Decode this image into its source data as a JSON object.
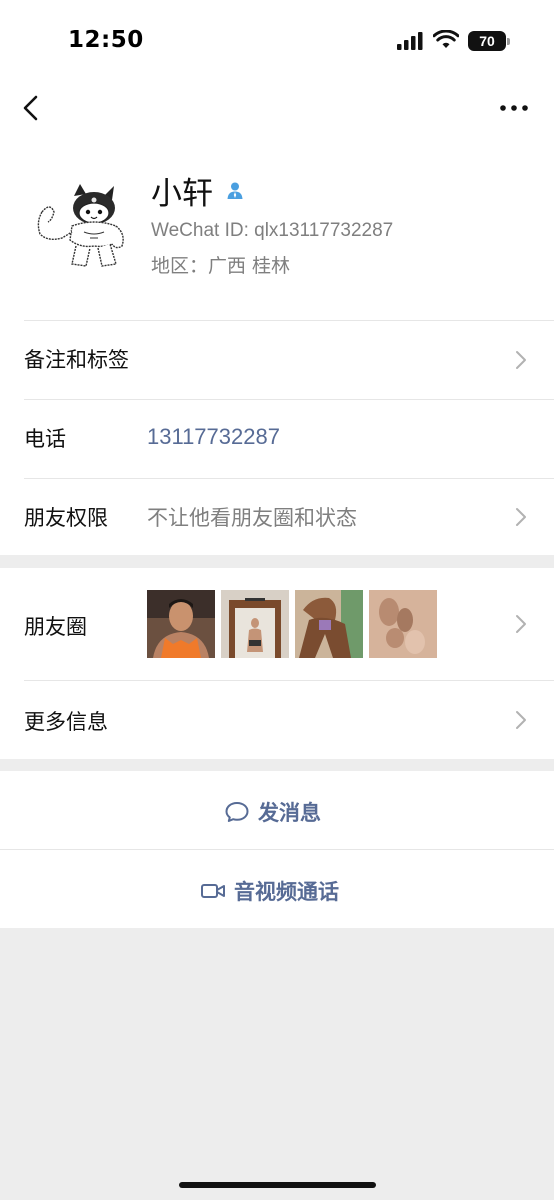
{
  "status_bar": {
    "time": "12:50",
    "battery": "70"
  },
  "profile": {
    "name": "小轩",
    "wechat_id": "WeChat ID: qlx13117732287",
    "region": "地区：广西 桂林"
  },
  "rows": {
    "remark": {
      "label": "备注和标签"
    },
    "phone": {
      "label": "电话",
      "value": "13117732287"
    },
    "permissions": {
      "label": "朋友权限",
      "value": "不让他看朋友圈和状态"
    },
    "moments": {
      "label": "朋友圈"
    },
    "more_info": {
      "label": "更多信息"
    }
  },
  "actions": {
    "message": "发消息",
    "call": "音视频通话"
  },
  "colors": {
    "link": "#576b95",
    "background": "#ededed",
    "secondary_text": "#7f7f7f",
    "verified": "#4a9fe0"
  },
  "icons": [
    "back-icon",
    "more-icon",
    "verified-icon",
    "chevron-right-icon",
    "chat-icon",
    "video-icon"
  ]
}
